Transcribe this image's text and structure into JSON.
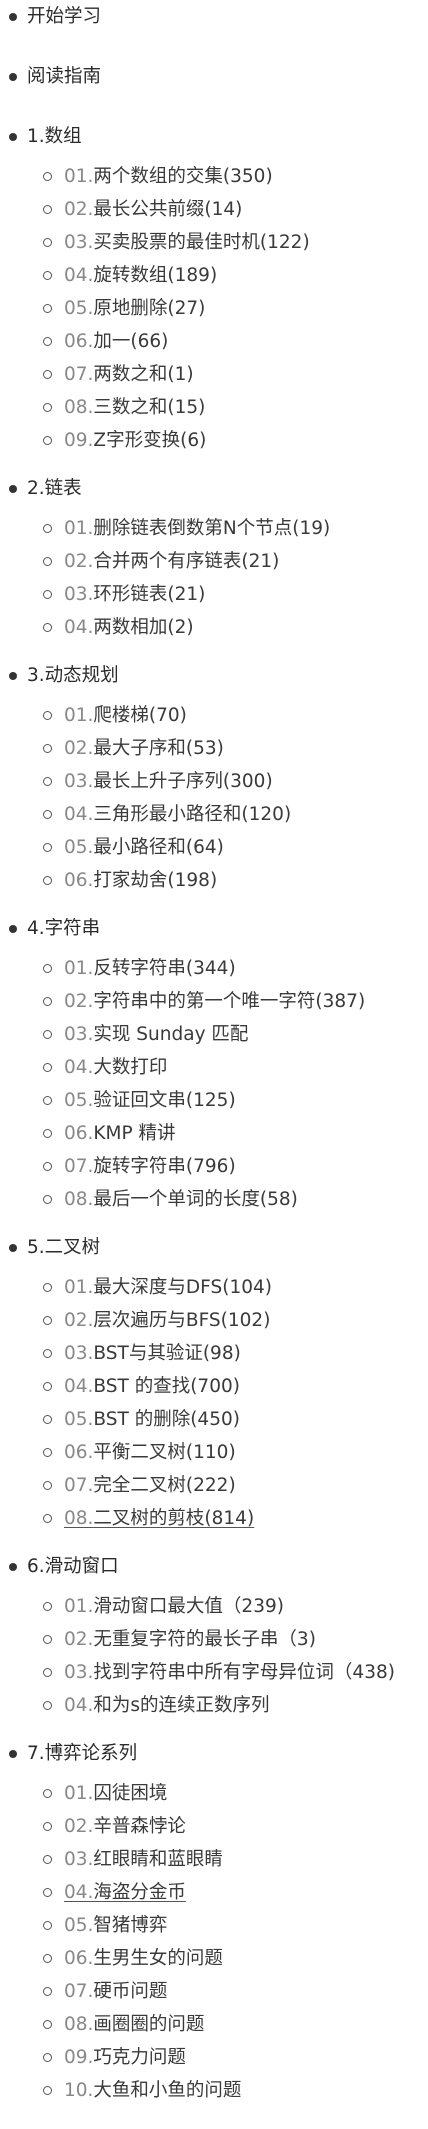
{
  "sections": [
    {
      "label": "开始学习",
      "items": []
    },
    {
      "label": "阅读指南",
      "items": []
    },
    {
      "label": "1.数组",
      "items": [
        {
          "num": "01.",
          "text": "两个数组的交集(350)"
        },
        {
          "num": "02.",
          "text": "最长公共前缀(14)"
        },
        {
          "num": "03.",
          "text": "买卖股票的最佳时机(122)"
        },
        {
          "num": "04.",
          "text": "旋转数组(189)"
        },
        {
          "num": "05.",
          "text": "原地删除(27)"
        },
        {
          "num": "06.",
          "text": "加一(66)"
        },
        {
          "num": "07.",
          "text": "两数之和(1)"
        },
        {
          "num": "08.",
          "text": "三数之和(15)"
        },
        {
          "num": "09.",
          "text": "Z字形变换(6)"
        }
      ]
    },
    {
      "label": "2.链表",
      "items": [
        {
          "num": "01.",
          "text": "删除链表倒数第N个节点(19)"
        },
        {
          "num": "02.",
          "text": "合并两个有序链表(21)"
        },
        {
          "num": "03.",
          "text": "环形链表(21)"
        },
        {
          "num": "04.",
          "text": "两数相加(2)"
        }
      ]
    },
    {
      "label": "3.动态规划",
      "items": [
        {
          "num": "01.",
          "text": "爬楼梯(70)"
        },
        {
          "num": "02.",
          "text": "最大子序和(53)"
        },
        {
          "num": "03.",
          "text": "最长上升子序列(300)"
        },
        {
          "num": "04.",
          "text": "三角形最小路径和(120)"
        },
        {
          "num": "05.",
          "text": "最小路径和(64)"
        },
        {
          "num": "06.",
          "text": "打家劫舍(198)"
        }
      ]
    },
    {
      "label": "4.字符串",
      "items": [
        {
          "num": "01.",
          "text": "反转字符串(344)"
        },
        {
          "num": "02.",
          "text": "字符串中的第一个唯一字符(387)"
        },
        {
          "num": "03.",
          "text": "实现 Sunday 匹配"
        },
        {
          "num": "04.",
          "text": "大数打印"
        },
        {
          "num": "05.",
          "text": "验证回文串(125)"
        },
        {
          "num": "06.",
          "text": "KMP 精讲"
        },
        {
          "num": "07.",
          "text": "旋转字符串(796)"
        },
        {
          "num": "08.",
          "text": "最后一个单词的长度(58)"
        }
      ]
    },
    {
      "label": "5.二叉树",
      "items": [
        {
          "num": "01.",
          "text": "最大深度与DFS(104)"
        },
        {
          "num": "02.",
          "text": "层次遍历与BFS(102)"
        },
        {
          "num": "03.",
          "text": "BST与其验证(98)"
        },
        {
          "num": "04.",
          "text": "BST 的查找(700)"
        },
        {
          "num": "05.",
          "text": "BST 的删除(450)"
        },
        {
          "num": "06.",
          "text": "平衡二叉树(110)"
        },
        {
          "num": "07.",
          "text": "完全二叉树(222)"
        },
        {
          "num": "08.",
          "text": "二叉树的剪枝(814)",
          "link": true
        }
      ]
    },
    {
      "label": "6.滑动窗口",
      "items": [
        {
          "num": "01.",
          "text": "滑动窗口最大值（239)"
        },
        {
          "num": "02.",
          "text": "无重复字符的最长子串（3)"
        },
        {
          "num": "03.",
          "text": "找到字符串中所有字母异位词（438)"
        },
        {
          "num": "04.",
          "text": "和为s的连续正数序列"
        }
      ]
    },
    {
      "label": "7.博弈论系列",
      "items": [
        {
          "num": "01.",
          "text": "囚徒困境"
        },
        {
          "num": "02.",
          "text": "辛普森悖论"
        },
        {
          "num": "03.",
          "text": "红眼睛和蓝眼睛"
        },
        {
          "num": "04.",
          "text": "海盗分金币",
          "link": true
        },
        {
          "num": "05.",
          "text": "智猪博弈"
        },
        {
          "num": "06.",
          "text": "生男生女的问题"
        },
        {
          "num": "07.",
          "text": "硬币问题"
        },
        {
          "num": "08.",
          "text": "画圈圈的问题"
        },
        {
          "num": "09.",
          "text": "巧克力问题"
        },
        {
          "num": "10.",
          "text": "大鱼和小鱼的问题"
        }
      ]
    }
  ]
}
